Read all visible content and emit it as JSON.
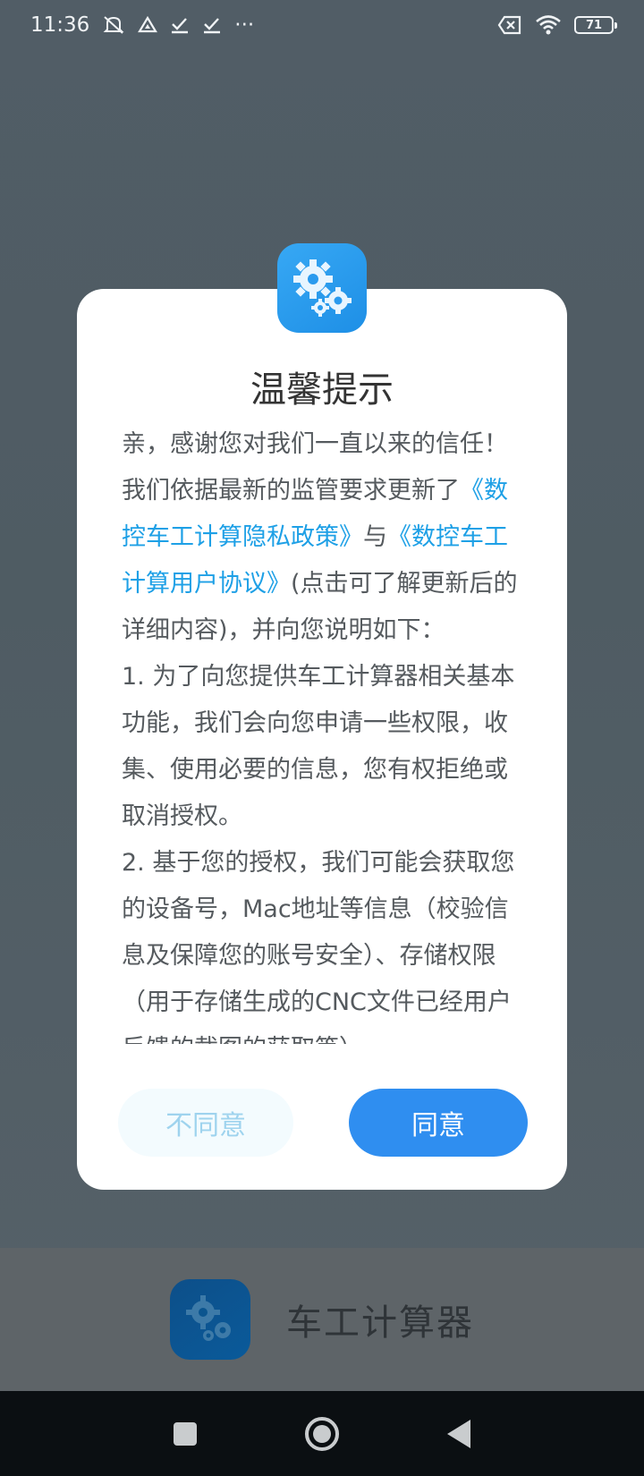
{
  "status_bar": {
    "time": "11:36",
    "battery": "71",
    "icons": [
      "mute-icon",
      "drive-icon",
      "check-icon",
      "check-icon",
      "more-dots-icon",
      "no-sim-icon",
      "wifi-icon",
      "battery-icon"
    ],
    "more": "···"
  },
  "dialog": {
    "title": "温馨提示",
    "body": {
      "p1": "亲，感谢您对我们一直以来的信任！",
      "p2_before": "我们依据最新的监管要求更新了",
      "link_privacy": "《数控车工计算隐私政策》",
      "p2_mid": "与",
      "link_agreement": "《数控车工计算用户协议》",
      "p2_after": "(点击可了解更新后的详细内容)，并向您说明如下：",
      "p3": "1. 为了向您提供车工计算器相关基本功能，我们会向您申请一些权限，收集、使用必要的信息，您有权拒绝或取消授权。",
      "p4": "2. 基于您的授权，我们可能会获取您的设备号，Mac地址等信息（校验信息及保障您的账号安全）、存储权限（用于存储生成的CNC文件已经用户反馈的截图的获取等）"
    },
    "buttons": {
      "disagree": "不同意",
      "agree": "同意"
    }
  },
  "splash": {
    "app_name": "车工计算器"
  },
  "colors": {
    "accent": "#2f8ef0",
    "link": "#1ea0e6",
    "overlay": "#515d66"
  }
}
